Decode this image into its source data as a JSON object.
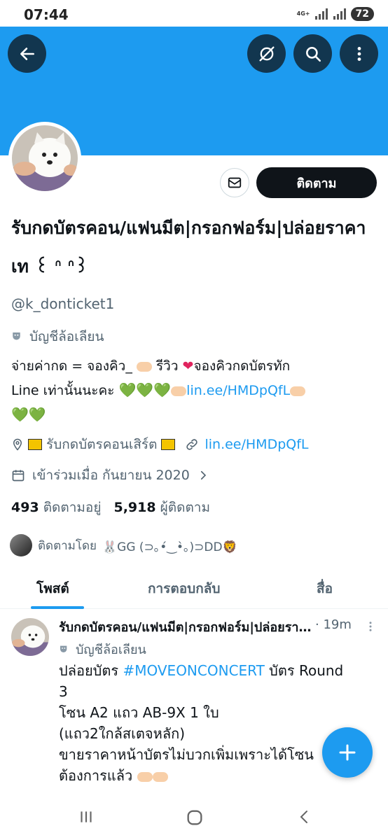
{
  "status": {
    "time": "07:44",
    "network": "4G+",
    "battery": "72"
  },
  "colors": {
    "accent": "#1d9bf0",
    "text": "#0f1419",
    "muted": "#536471",
    "heart": "#00c853"
  },
  "header": {
    "back_icon": "arrow-left-icon",
    "mute_icon": "no-notifications-icon",
    "search_icon": "search-icon",
    "more_icon": "more-vertical-icon"
  },
  "profile": {
    "display_name": "รับกดบัตรคอน/แฟนมีต|กรอกฟอร์ม|ปล่อยราคาเท ꒰ ᐢ ᐢ꒱",
    "handle": "@k_donticket1",
    "parody_label": "บัญชีล้อเลียน",
    "follow_label": "ติดตาม",
    "bio": {
      "line1_prefix": "จ่ายค่ากด = จองคิว_",
      "line1_mid": " รีวิว ",
      "line1_suffix": "จองคิวกดบัตรทัก",
      "line2_prefix": "Line เท่านั้นนะคะ ",
      "hearts_a": "💚💚💚",
      "link": "lin.ee/HMDpQfL",
      "hearts_b": "💚💚"
    },
    "location": "รับกดบัตรคอนเสิร์ต",
    "website": "lin.ee/HMDpQfL",
    "joined": "เข้าร่วมเมื่อ กันยายน 2020",
    "following_count": "493",
    "following_label": "ติดตามอยู่",
    "followers_count": "5,918",
    "followers_label": "ผู้ติดตาม",
    "followed_by_prefix": "ติดตามโดย",
    "followed_by_names": "🐰GG (⊃｡•́‿•̀｡)⊃DD🦁"
  },
  "tabs": [
    {
      "label": "โพสต์",
      "active": true
    },
    {
      "label": "การตอบกลับ",
      "active": false
    },
    {
      "label": "สื่อ",
      "active": false
    }
  ],
  "tweet": {
    "name": "รับกดบัตรคอน/แฟนมีต|กรอกฟอร์ม|ปล่อยราคาเท",
    "time": "· 19m",
    "parody_label": "บัญชีล้อเลียน",
    "line1_prefix": "ปล่อยบัตร ",
    "hashtag": "#MOVEONCONCERT",
    "line1_suffix": " บัตร Round",
    "line2": "3",
    "line3": "โซน A2 แถว AB-9X 1 ใบ",
    "line4": "(แถว2ใกล้สเตจหลัก)",
    "line5": "ขายราคาหน้าบัตรไม่บวกเพิ่มเพราะได้โซน",
    "line6": "ต้องการแล้ว"
  },
  "fab_icon": "plus-icon",
  "nav": {
    "recents_icon": "recents-icon",
    "home_icon": "home-icon",
    "back_icon": "nav-back-icon"
  }
}
